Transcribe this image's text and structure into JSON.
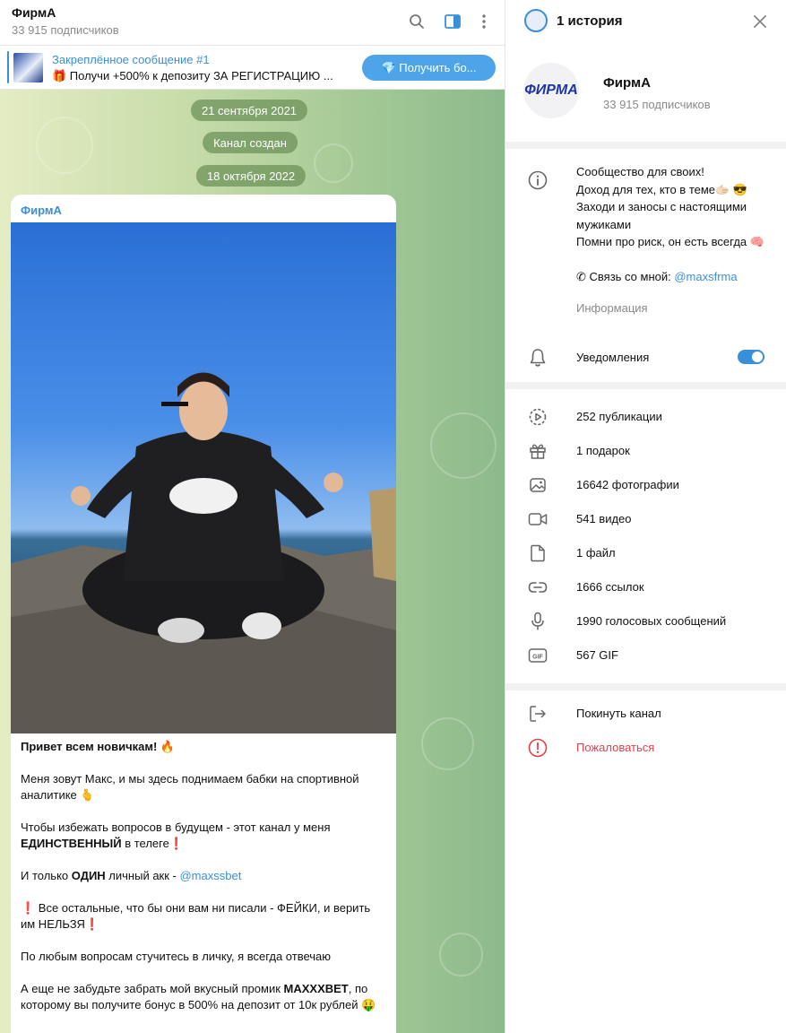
{
  "header": {
    "title": "ФирмА",
    "subscribers": "33 915 подписчиков",
    "icons": [
      "search-icon",
      "sidebar-toggle-icon",
      "more-vertical-icon"
    ]
  },
  "pinned": {
    "title": "Закреплённое сообщение #1",
    "text": "🎁 Получи +500% к депозиту ЗА РЕГИСТРАЦИЮ ...",
    "button_label": "💎 Получить бо..."
  },
  "chat": {
    "dates": [
      "21 сентября 2021",
      "Канал создан",
      "18 октября 2022"
    ],
    "message": {
      "author": "ФирмА",
      "p1": "Привет всем новичкам! 🔥",
      "p2": "Меня зовут Макс, и мы здесь поднимаем бабки на спортивной аналитике 🫰",
      "p3_before": "Чтобы избежать вопросов в будущем - этот канал у меня ",
      "p3_bold": "ЕДИНСТВЕННЫЙ",
      "p3_after": " в телеге❗",
      "p4_before": "И только ",
      "p4_bold": "ОДИН",
      "p4_mid": " личный акк - ",
      "p4_link": "@maxssbet",
      "p5": "❗ Все остальные, что бы они вам ни писали - ФЕЙКИ, и верить им НЕЛЬЗЯ❗",
      "p6": "По любым вопросам стучитесь в личку, я всегда отвечаю",
      "p7_before": "А еще не забудьте забрать мой вкусный промик ",
      "p7_bold": "MAXXXBET",
      "p7_after": ", по которому вы получите бонус в 500% на депозит от 10к рублей 🤑"
    }
  },
  "panel": {
    "stories_title": "1 история",
    "name": "ФирмА",
    "subscribers": "33 915 подписчиков",
    "avatar_text": "ФИРМА",
    "description_lines": [
      "Сообщество для своих!",
      "Доход для тех, кто в теме🫱🏻 😎",
      "Заходи и заносы с настоящими мужиками",
      "Помни про риск, он есть всегда 🧠"
    ],
    "contact_before": "✆ Связь со мной: ",
    "contact_link": "@maxsfrma",
    "info_label": "Информация",
    "notifications_label": "Уведомления",
    "notifications_on": true,
    "media": [
      {
        "icon": "publications-icon",
        "label": "252 публикации"
      },
      {
        "icon": "gift-icon",
        "label": "1 подарок"
      },
      {
        "icon": "photo-icon",
        "label": "16642 фотографии"
      },
      {
        "icon": "video-icon",
        "label": "541 видео"
      },
      {
        "icon": "file-icon",
        "label": "1 файл"
      },
      {
        "icon": "link-icon",
        "label": "1666 ссылок"
      },
      {
        "icon": "microphone-icon",
        "label": "1990 голосовых сообщений"
      },
      {
        "icon": "gif-icon",
        "label": "567 GIF"
      }
    ],
    "leave_label": "Покинуть канал",
    "report_label": "Пожаловаться",
    "accent_color": "#3a8fd9",
    "danger_color": "#e0414a"
  }
}
